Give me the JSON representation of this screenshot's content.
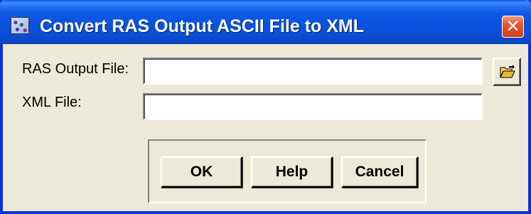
{
  "window": {
    "title": "Convert RAS Output ASCII File to XML",
    "close_glyph": "✕",
    "app_icon": "map-app-icon"
  },
  "fields": {
    "ras_output_label": "RAS Output File:",
    "ras_output_value": "",
    "xml_file_label": "XML File:",
    "xml_file_value": "",
    "browse_icon": "open-folder-icon"
  },
  "buttons": {
    "ok_label": "OK",
    "help_label": "Help",
    "cancel_label": "Cancel"
  },
  "colors": {
    "titlebar": "#0a52dc",
    "dialog_background": "#ece9d8",
    "close_button": "#e4582f"
  }
}
